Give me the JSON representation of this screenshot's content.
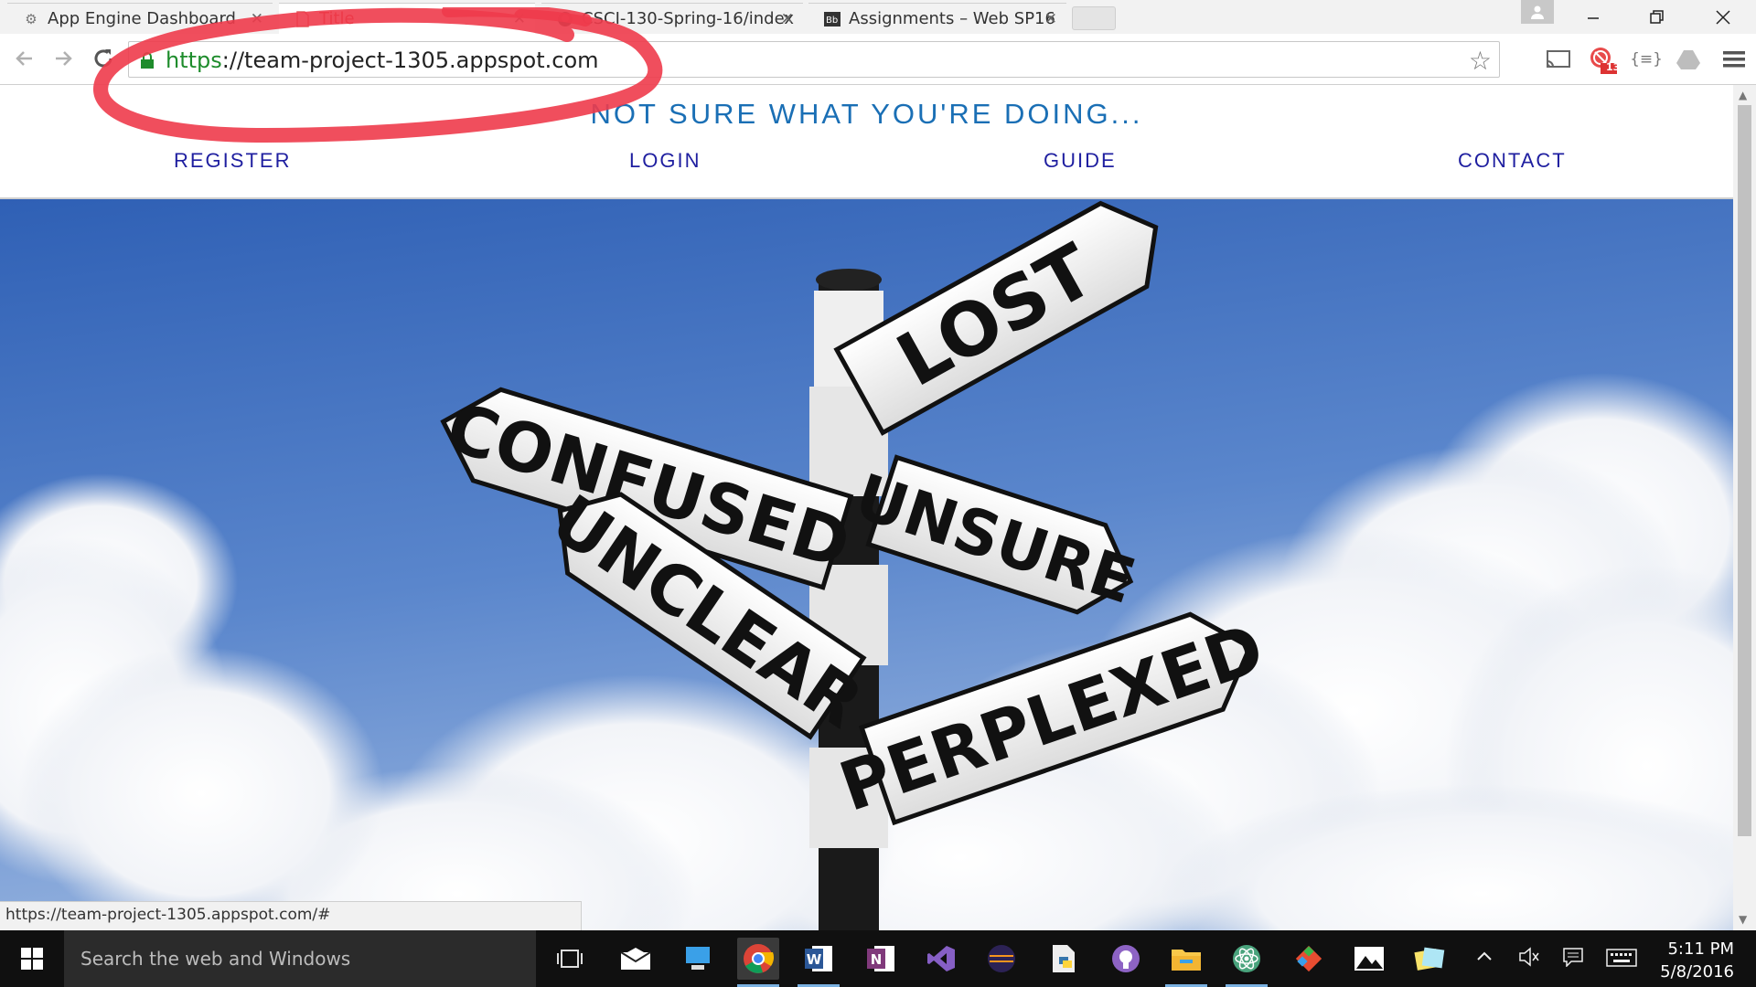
{
  "browser": {
    "tabs": [
      {
        "title": "App Engine Dashboard",
        "icon": "gear-icon",
        "active": false
      },
      {
        "title": "Title",
        "icon": "document-icon",
        "active": true
      },
      {
        "title": "CSCI-130-Spring-16/index",
        "icon": "github-icon",
        "active": false
      },
      {
        "title": "Assignments – Web SP16",
        "icon": "blackboard-icon",
        "active": false
      }
    ],
    "tab_close_glyph": "✕",
    "omnibox": {
      "scheme": "https",
      "rest": "://team-project-1305.appspot.com"
    },
    "extension_badge": "13",
    "extension_braces": "{≡}"
  },
  "page": {
    "heading": "NOT SURE WHAT YOU'RE DOING...",
    "nav": [
      "REGISTER",
      "LOGIN",
      "GUIDE",
      "CONTACT"
    ],
    "signs": {
      "lost": "LOST",
      "confused": "CONFUSED",
      "unsure": "UNSURE",
      "unclear": "UNCLEAR",
      "perplexed": "PERPLEXED"
    }
  },
  "status_url": "https://team-project-1305.appspot.com/#",
  "taskbar": {
    "search_placeholder": "Search the web and Windows",
    "time": "5:11 PM",
    "date": "5/8/2016"
  },
  "colors": {
    "heading": "#1a6fb5",
    "nav_link": "#1f1fa0",
    "annotation": "#ee3b4b",
    "https_green": "#1e8c2c"
  }
}
